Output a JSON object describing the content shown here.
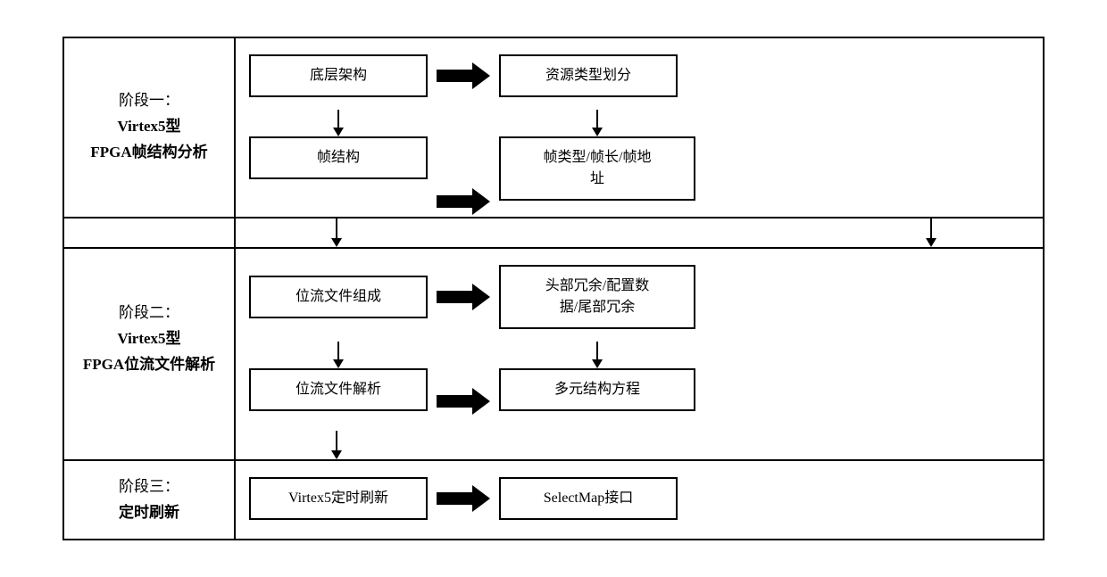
{
  "diagram": {
    "stage1": {
      "label_line1": "阶段一：",
      "label_line2": "Virtex5型",
      "label_line3": "FPGA帧结构分析",
      "flow1": {
        "box1": "底层架构",
        "box2": "资源类型划分"
      },
      "flow2": {
        "box1": "帧结构",
        "box2": "帧类型/帧长/帧地\n址"
      }
    },
    "stage2": {
      "label_line1": "阶段二：",
      "label_line2": "Virtex5型",
      "label_line3": "FPGA位流文件解析",
      "flow1": {
        "box1": "位流文件组成",
        "box2": "头部冗余/配置数\n据/尾部冗余"
      },
      "flow2": {
        "box1": "位流文件解析",
        "box2": "多元结构方程"
      }
    },
    "stage3": {
      "label_line1": "阶段三：",
      "label_line2": "定时刷新",
      "flow1": {
        "box1": "Virtex5定时刷新",
        "box2": "SelectMap接口"
      }
    }
  }
}
